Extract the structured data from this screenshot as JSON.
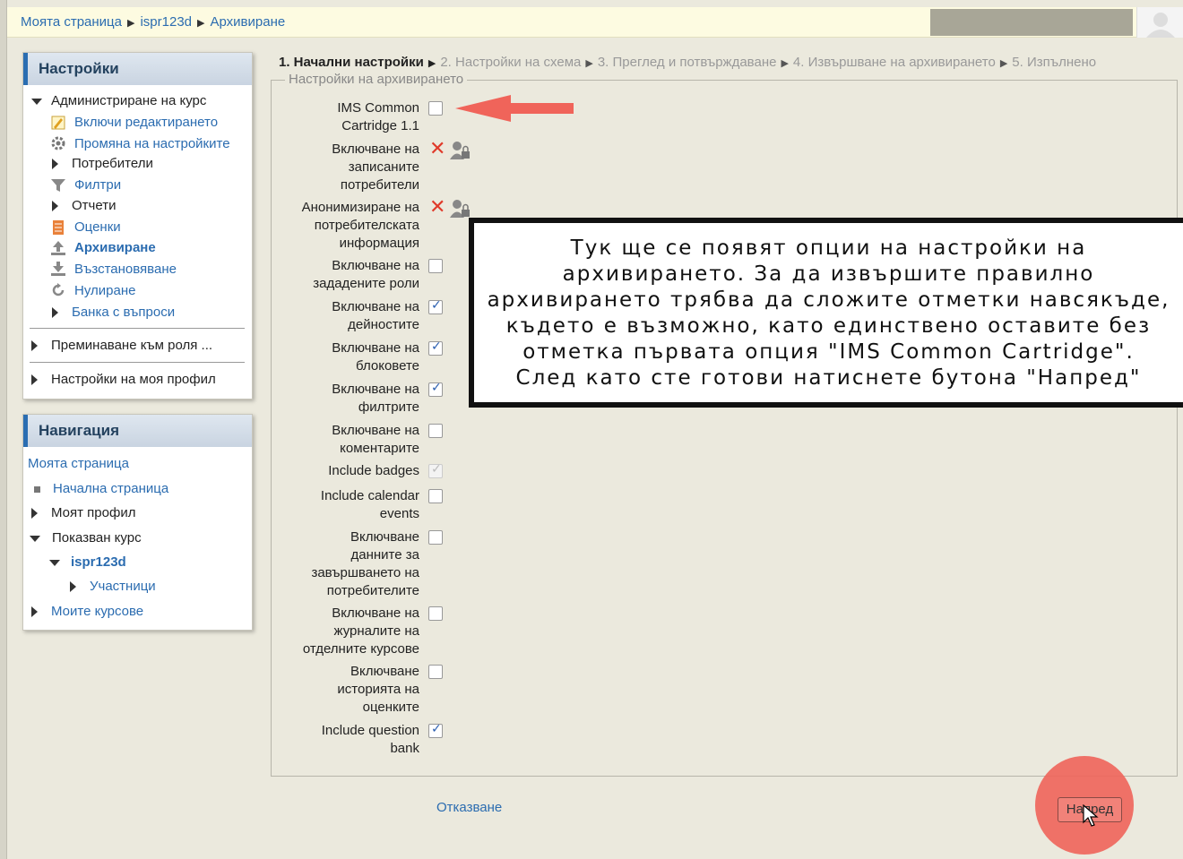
{
  "breadcrumb": {
    "items": [
      "Моята страница",
      "ispr123d",
      "Архивиране"
    ],
    "sep": "▶"
  },
  "settings_block": {
    "title": "Настройки",
    "items": [
      "Администриране на курс",
      "Включи редактирането",
      "Промяна на настройките",
      "Потребители",
      "Филтри",
      "Отчети",
      "Оценки",
      "Архивиране",
      "Възстановяване",
      "Нулиране",
      "Банка с въпроси",
      "Преминаване към роля ...",
      "Настройки на моя профил"
    ]
  },
  "nav_block": {
    "title": "Навигация",
    "items": [
      "Моята страница",
      "Начална страница",
      "Моят профил",
      "Показван курс",
      "ispr123d",
      "Участници",
      "Моите курсове"
    ]
  },
  "steps": {
    "current": "1. Начални настройки",
    "rest": [
      "2. Настройки на схема",
      "3. Преглед и потвърждаване",
      "4. Извършване на архивирането",
      "5. Изпълнено"
    ],
    "sep": "▶"
  },
  "legend": "Настройки на архивирането",
  "options": [
    {
      "label": [
        "IMS Common",
        "Cartridge 1.1"
      ],
      "state": "unchecked"
    },
    {
      "label": [
        "Включване на",
        "записаните",
        "потребители"
      ],
      "state": "locked"
    },
    {
      "label": [
        "Анонимизиране на",
        "потребителската",
        "информация"
      ],
      "state": "locked"
    },
    {
      "label": [
        "Включване на",
        "зададените роли"
      ],
      "state": "unchecked"
    },
    {
      "label": [
        "Включване на",
        "дейностите"
      ],
      "state": "checked"
    },
    {
      "label": [
        "Включване на",
        "блоковете"
      ],
      "state": "checked"
    },
    {
      "label": [
        "Включване на",
        "филтрите"
      ],
      "state": "checked"
    },
    {
      "label": [
        "Включване на",
        "коментарите"
      ],
      "state": "unchecked"
    },
    {
      "label": [
        "Include badges"
      ],
      "state": "disabled-checked"
    },
    {
      "label": [
        "Include calendar",
        "events"
      ],
      "state": "unchecked"
    },
    {
      "label": [
        "Включване",
        "данните за",
        "завършването на",
        "потребителите"
      ],
      "state": "unchecked"
    },
    {
      "label": [
        "Включване на",
        "журналите на",
        "отделните курсове"
      ],
      "state": "unchecked"
    },
    {
      "label": [
        "Включване",
        "историята на",
        "оценките"
      ],
      "state": "unchecked"
    },
    {
      "label": [
        "Include question",
        "bank"
      ],
      "state": "checked"
    }
  ],
  "callout": {
    "lines": [
      "Тук ще се появят опции на настройки на",
      "архивирането. За да извършите правилно",
      "архивирането трябва да сложите отметки навсякъде,",
      "където е възможно, като единствено оставите без",
      "отметка първата опция \"IMS Common Cartridge\".",
      "След като сте готови натиснете бутона \"Напред\""
    ]
  },
  "buttons": {
    "cancel": "Отказване",
    "next": "Напред"
  },
  "colors": {
    "link": "#2b6cb0",
    "accent": "#2a6db1",
    "highlight": "#f0645a"
  }
}
